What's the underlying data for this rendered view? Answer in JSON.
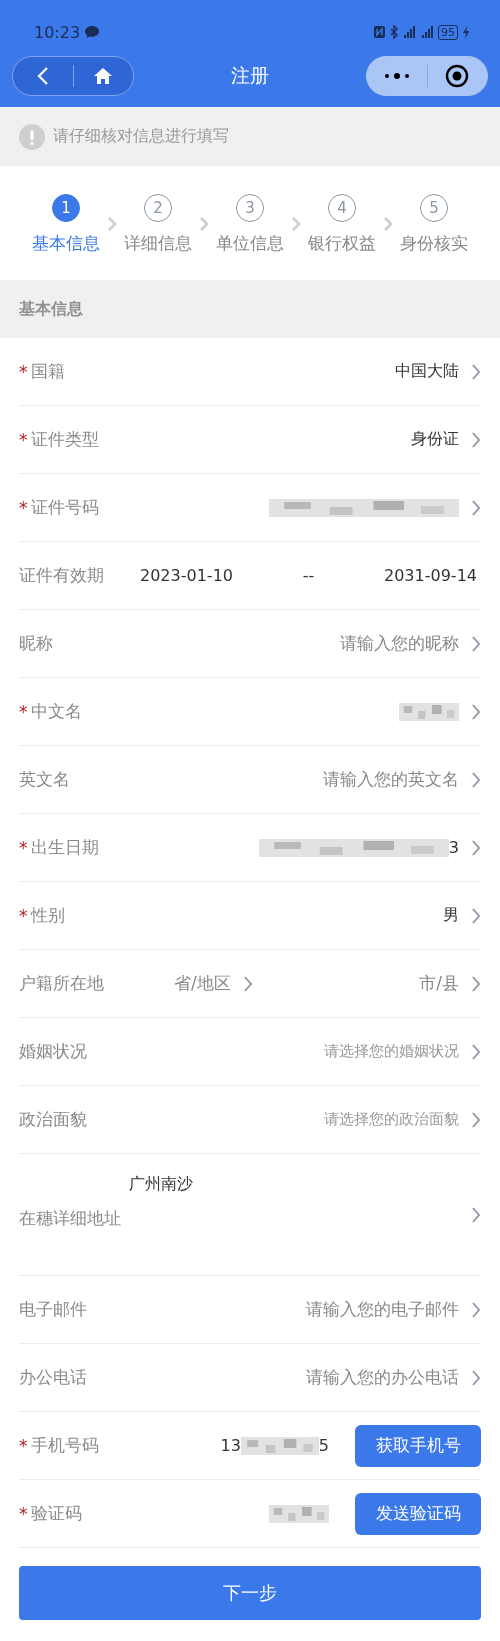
{
  "status_bar": {
    "time": "10:23",
    "battery": "95"
  },
  "nav": {
    "title": "注册"
  },
  "notice": {
    "text": "请仔细核对信息进行填写"
  },
  "steps": [
    {
      "number": "1",
      "label": "基本信息",
      "selected": true
    },
    {
      "number": "2",
      "label": "详细信息",
      "selected": false
    },
    {
      "number": "3",
      "label": "单位信息",
      "selected": false
    },
    {
      "number": "4",
      "label": "银行权益",
      "selected": false
    },
    {
      "number": "5",
      "label": "身份核实",
      "selected": false
    }
  ],
  "section": {
    "title": "基本信息"
  },
  "rows": [
    {
      "kind": "select",
      "label": "国籍",
      "mark": "*",
      "value": "中国大陆"
    },
    {
      "kind": "select",
      "label": "证件类型",
      "mark": "*",
      "value": "身份证"
    },
    {
      "kind": "select",
      "label": "证件号码",
      "mark": "*",
      "masked": true
    },
    {
      "kind": "date_range",
      "label": "证件有效期",
      "start": "2023-01-10",
      "separator": "--",
      "end": "2031-09-14"
    },
    {
      "kind": "select",
      "label": "昵称",
      "placeholder": "请输入您的昵称"
    },
    {
      "kind": "select",
      "label": "中文名",
      "mark": "*",
      "masked": true
    },
    {
      "kind": "select",
      "label": "英文名",
      "placeholder": "请输入您的英文名"
    },
    {
      "kind": "select",
      "label": "出生日期",
      "mark": "*",
      "masked": true,
      "suffix": "3"
    },
    {
      "kind": "select",
      "label": "性别",
      "mark": "*",
      "value": "男"
    },
    {
      "kind": "region",
      "label": "户籍所在地",
      "province": "省/地区",
      "city": "市/县"
    },
    {
      "kind": "select",
      "label": "婚姻状况",
      "placeholder": "请选择您的婚姻状况",
      "small": true
    },
    {
      "kind": "select",
      "label": "政治面貌",
      "placeholder": "请选择您的政治面貌",
      "small": true
    },
    {
      "kind": "address",
      "label": "在穗详细地址",
      "value": "广州南沙"
    },
    {
      "kind": "select",
      "label": "电子邮件",
      "placeholder": "请输入您的电子邮件"
    },
    {
      "kind": "select",
      "label": "办公电话",
      "placeholder": "请输入您的办公电话"
    },
    {
      "kind": "action",
      "label": "手机号码",
      "mark": "*",
      "masked": true,
      "prefix": "13",
      "suffix": "5",
      "button": "获取手机号"
    },
    {
      "kind": "action",
      "label": "验证码",
      "mark": "*",
      "masked": true,
      "button": "发送验证码"
    }
  ],
  "next_button": "下一步"
}
